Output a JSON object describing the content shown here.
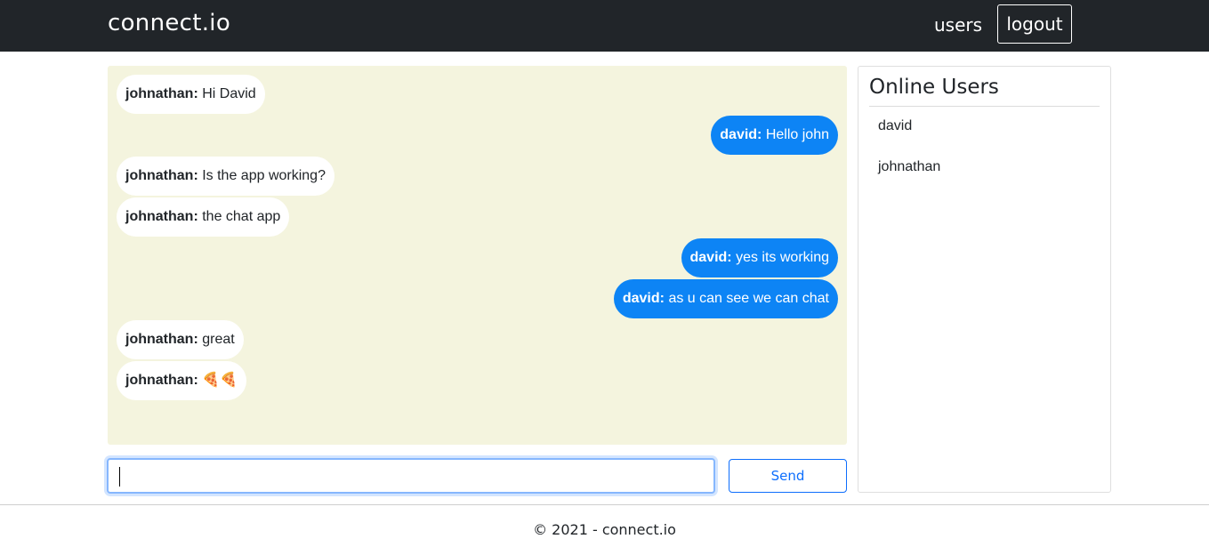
{
  "nav": {
    "brand": "connect.io",
    "users_link": "users",
    "logout_button": "logout"
  },
  "messages": [
    {
      "sender": "johnathan:",
      "text": "Hi David",
      "direction": "incoming"
    },
    {
      "sender": "david:",
      "text": "Hello john",
      "direction": "outgoing"
    },
    {
      "sender": "johnathan:",
      "text": "Is the app working?",
      "direction": "incoming"
    },
    {
      "sender": "johnathan:",
      "text": "the chat app",
      "direction": "incoming"
    },
    {
      "sender": "david:",
      "text": "yes its working",
      "direction": "outgoing"
    },
    {
      "sender": "david:",
      "text": "as u can see we can chat",
      "direction": "outgoing"
    },
    {
      "sender": "johnathan:",
      "text": "great",
      "direction": "incoming"
    },
    {
      "sender": "johnathan:",
      "text": "🍕🍕",
      "direction": "incoming"
    }
  ],
  "composer": {
    "input_value": "",
    "send_button": "Send"
  },
  "online_users": {
    "title": "Online Users",
    "users": [
      "david",
      "johnathan"
    ]
  },
  "footer": {
    "text": "© 2021 - connect.io"
  },
  "colors": {
    "navbar": "#212529",
    "chat_background": "#f4f4de",
    "outgoing_bubble": "#0d84f5",
    "incoming_bubble": "#ffffff",
    "send_accent": "#0d6efd"
  }
}
